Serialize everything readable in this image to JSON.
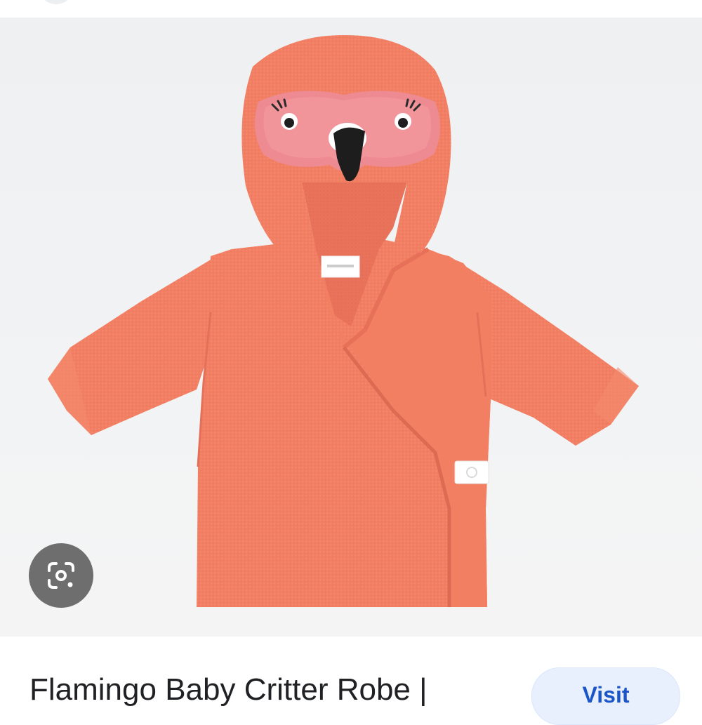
{
  "colors": {
    "page_background": "#ffffff",
    "image_background": "#f0f1f3",
    "robe": "#f27f63",
    "mask": "#ee8a91",
    "title_text": "#202124",
    "visit_button_bg": "#e8f0fe",
    "visit_button_text": "#1a56c8",
    "lens_button_bg": "#505050"
  },
  "image": {
    "icon": "flamingo-robe-image"
  },
  "lens_button": {
    "icon": "google-lens-icon"
  },
  "result": {
    "title": "Flamingo Baby Critter Robe |",
    "visit_label": "Visit"
  }
}
